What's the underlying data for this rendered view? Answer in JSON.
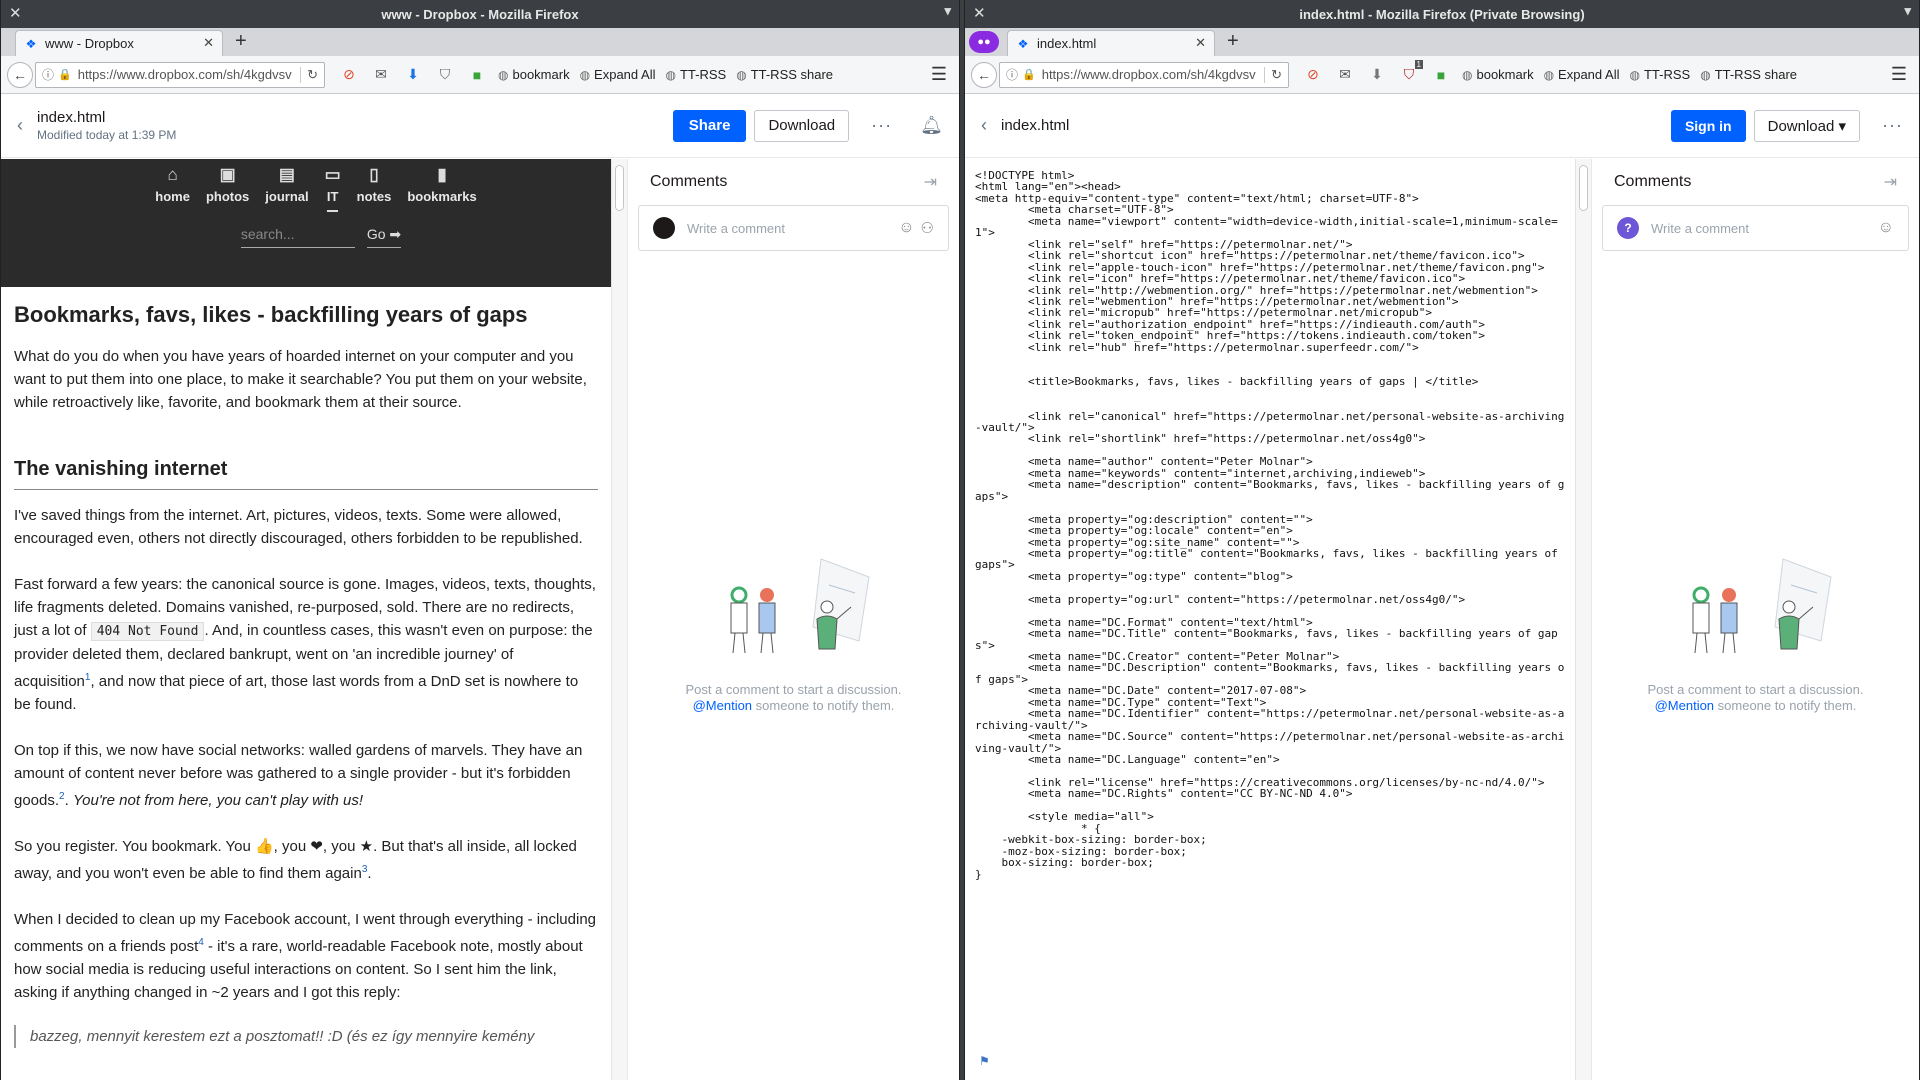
{
  "left": {
    "window_title": "www - Dropbox - Mozilla Firefox",
    "tab_title": "www - Dropbox",
    "url": "https://www.dropbox.com/sh/4kgdvsv",
    "bookmarks": [
      "bookmark",
      "Expand All",
      "TT-RSS",
      "TT-RSS share"
    ],
    "file_name": "index.html",
    "file_modified": "Modified today at 1:39 PM",
    "share_label": "Share",
    "download_label": "Download",
    "more_label": "···",
    "site_nav": [
      {
        "icon": "home-icon",
        "glyph": "⌂",
        "label": "home"
      },
      {
        "icon": "photos-icon",
        "glyph": "▣",
        "label": "photos"
      },
      {
        "icon": "journal-icon",
        "glyph": "▤",
        "label": "journal"
      },
      {
        "icon": "it-icon",
        "glyph": "▭",
        "label": "IT"
      },
      {
        "icon": "notes-icon",
        "glyph": "▯",
        "label": "notes"
      },
      {
        "icon": "bookmarks-icon",
        "glyph": "▮",
        "label": "bookmarks"
      }
    ],
    "search_placeholder": "search...",
    "search_go": "Go ➡",
    "article": {
      "title": "Bookmarks, favs, likes - backfilling years of gaps",
      "intro": "What do you do when you have years of hoarded internet on your computer and you want to put them into one place, to make it searchable? You put them on your website, while retroactively like, favorite, and bookmark them at their source.",
      "h2": "The vanishing internet",
      "p1": "I've saved things from the internet. Art, pictures, videos, texts. Some were allowed, encouraged even, others not directly discouraged, others forbidden to be republished.",
      "p2a": "Fast forward a few years: the canonical source is gone. Images, videos, texts, thoughts, life fragments deleted. Domains vanished, re-purposed, sold. There are no redirects, just a lot of ",
      "p2code": "404 Not Found",
      "p2b": ". And, in countless cases, this wasn't even on purpose: the provider deleted them, declared bankrupt, went on 'an incredible journey' of acquisition",
      "p2sup": "1",
      "p2c": ", and now that piece of art, those last words from a DnD set is nowhere to be found.",
      "p3a": "On top if this, we now have social networks: walled gardens of marvels. They have an amount of content never before was gathered to a single provider - but it's forbidden goods.",
      "p3sup": "2",
      "p3em": "You're not from here, you can't play with us!",
      "p4a": "So you register. You bookmark. You 👍, you ❤, you ★. But that's all inside, all locked away, and you won't even be able to find them again",
      "p4sup": "3",
      "p4b": ".",
      "p5a": "When I decided to clean up my Facebook account, I went through everything - including comments on a friends post",
      "p5sup": "4",
      "p5b": " - it's a rare, world-readable Facebook note, mostly about how social media is reducing useful interactions on content. So I sent him the link, asking if anything changed in ~2 years and I got this reply:",
      "quote": "bazzeg, mennyit kerestem ezt a posztomat!! :D (és ez így mennyire kemény"
    },
    "comments_title": "Comments",
    "comment_placeholder": "Write a comment",
    "empty_line1": "Post a comment to start a discussion.",
    "empty_mention": "@Mention",
    "empty_line2_rest": " someone to notify them."
  },
  "right": {
    "window_title": "index.html - Mozilla Firefox (Private Browsing)",
    "tab_title": "index.html",
    "url": "https://www.dropbox.com/sh/4kgdvsv",
    "bookmarks": [
      "bookmark",
      "Expand All",
      "TT-RSS",
      "TT-RSS share"
    ],
    "ublock_badge": "1",
    "file_name": "index.html",
    "signin_label": "Sign in",
    "download_label": "Download ▾",
    "more_label": "···",
    "comments_title": "Comments",
    "comment_placeholder": "Write a comment",
    "avatar_q": "?",
    "empty_line1": "Post a comment to start a discussion.",
    "empty_mention": "@Mention",
    "empty_line2_rest": " someone to notify them.",
    "source": "<!DOCTYPE html>\n<html lang=\"en\"><head>\n<meta http-equiv=\"content-type\" content=\"text/html; charset=UTF-8\">\n        <meta charset=\"UTF-8\">\n        <meta name=\"viewport\" content=\"width=device-width,initial-scale=1,minimum-scale=1\">\n        <link rel=\"self\" href=\"https://petermolnar.net/\">\n        <link rel=\"shortcut icon\" href=\"https://petermolnar.net/theme/favicon.ico\">\n        <link rel=\"apple-touch-icon\" href=\"https://petermolnar.net/theme/favicon.png\">\n        <link rel=\"icon\" href=\"https://petermolnar.net/theme/favicon.ico\">\n        <link rel=\"http://webmention.org/\" href=\"https://petermolnar.net/webmention\">\n        <link rel=\"webmention\" href=\"https://petermolnar.net/webmention\">\n        <link rel=\"micropub\" href=\"https://petermolnar.net/micropub\">\n        <link rel=\"authorization_endpoint\" href=\"https://indieauth.com/auth\">\n        <link rel=\"token_endpoint\" href=\"https://tokens.indieauth.com/token\">\n        <link rel=\"hub\" href=\"https://petermolnar.superfeedr.com/\">\n\n\n        <title>Bookmarks, favs, likes - backfilling years of gaps | </title>\n\n\n        <link rel=\"canonical\" href=\"https://petermolnar.net/personal-website-as-archiving-vault/\">\n        <link rel=\"shortlink\" href=\"https://petermolnar.net/oss4g0\">\n\n        <meta name=\"author\" content=\"Peter Molnar\">\n        <meta name=\"keywords\" content=\"internet,archiving,indieweb\">\n        <meta name=\"description\" content=\"Bookmarks, favs, likes - backfilling years of gaps\">\n\n        <meta property=\"og:description\" content=\"\">\n        <meta property=\"og:locale\" content=\"en\">\n        <meta property=\"og:site_name\" content=\"\">\n        <meta property=\"og:title\" content=\"Bookmarks, favs, likes - backfilling years of gaps\">\n        <meta property=\"og:type\" content=\"blog\">\n\n        <meta property=\"og:url\" content=\"https://petermolnar.net/oss4g0/\">\n\n        <meta name=\"DC.Format\" content=\"text/html\">\n        <meta name=\"DC.Title\" content=\"Bookmarks, favs, likes - backfilling years of gaps\">\n        <meta name=\"DC.Creator\" content=\"Peter Molnar\">\n        <meta name=\"DC.Description\" content=\"Bookmarks, favs, likes - backfilling years of gaps\">\n        <meta name=\"DC.Date\" content=\"2017-07-08\">\n        <meta name=\"DC.Type\" content=\"Text\">\n        <meta name=\"DC.Identifier\" content=\"https://petermolnar.net/personal-website-as-archiving-vault/\">\n        <meta name=\"DC.Source\" content=\"https://petermolnar.net/personal-website-as-archiving-vault/\">\n        <meta name=\"DC.Language\" content=\"en\">\n\n        <link rel=\"license\" href=\"https://creativecommons.org/licenses/by-nc-nd/4.0/\">\n        <meta name=\"DC.Rights\" content=\"CC BY-NC-ND 4.0\">\n\n        <style media=\"all\">\n                * {\n    -webkit-box-sizing: border-box;\n    -moz-box-sizing: border-box;\n    box-sizing: border-box;\n}"
  }
}
